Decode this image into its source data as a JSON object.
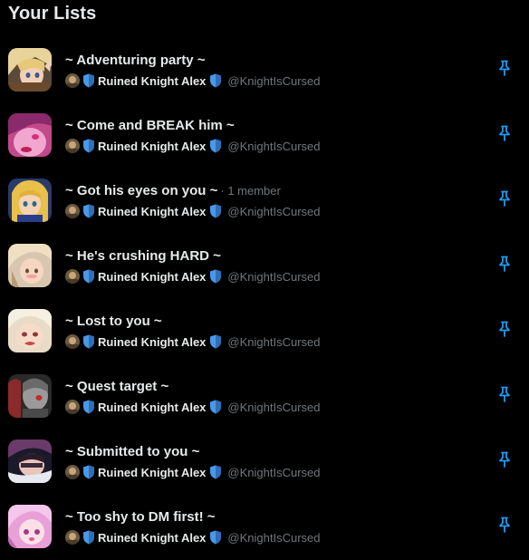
{
  "header": {
    "title": "Your Lists"
  },
  "colors": {
    "background": "#000000",
    "primary_text": "#e7e9ea",
    "secondary_text": "#71767b",
    "accent": "#1d9bf0",
    "shield": "#4a99e9"
  },
  "owner": {
    "name": "Ruined Knight Alex",
    "handle": "@KnightIsCursed"
  },
  "lists": [
    {
      "name": "~ Adventuring party ~",
      "member_count": ""
    },
    {
      "name": "~ Come and BREAK him ~",
      "member_count": ""
    },
    {
      "name": "~ Got his eyes on you ~",
      "member_count": "· 1 member"
    },
    {
      "name": "~ He's crushing HARD ~",
      "member_count": ""
    },
    {
      "name": "~ Lost to you ~",
      "member_count": ""
    },
    {
      "name": "~ Quest target ~",
      "member_count": ""
    },
    {
      "name": "~ Submitted to you ~",
      "member_count": ""
    },
    {
      "name": "~ Too shy to DM first! ~",
      "member_count": ""
    }
  ],
  "icons": {
    "pin": "pin-icon",
    "shield": "shield-icon"
  }
}
